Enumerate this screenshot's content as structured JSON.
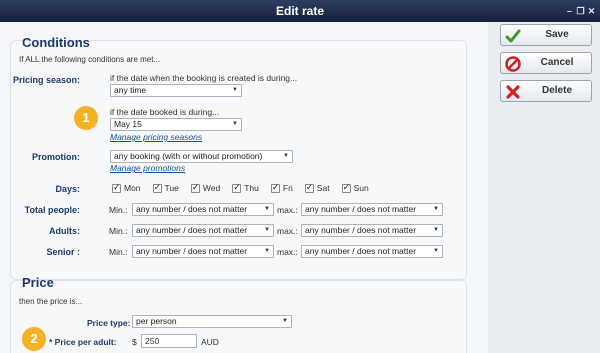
{
  "window": {
    "title": "Edit rate"
  },
  "conditions": {
    "title": "Conditions",
    "intro": "If ALL the following conditions are met...",
    "pricing_season": {
      "label": "Pricing season:",
      "text_created": "if the date when the booking is created is during...",
      "created_value": "any time",
      "text_booked": "if the date booked is during...",
      "booked_value": "May 15",
      "manage_link": "Manage pricing seasons"
    },
    "promotion": {
      "label": "Promotion:",
      "value": "any booking (with or without promotion)",
      "manage_link": "Manage promotions"
    },
    "days": {
      "label": "Days:",
      "items": [
        "Mon",
        "Tue",
        "Wed",
        "Thu",
        "Fri",
        "Sat",
        "Sun"
      ]
    },
    "people": [
      {
        "label": "Total people:",
        "min_label": "Min.:",
        "min_value": "any number / does not matter",
        "max_label": "max.:",
        "max_value": "any number / does not matter"
      },
      {
        "label": "Adults:",
        "min_label": "Min.:",
        "min_value": "any number / does not matter",
        "max_label": "max.:",
        "max_value": "any number / does not matter"
      },
      {
        "label": "Senior :",
        "min_label": "Min.:",
        "min_value": "any number / does not matter",
        "max_label": "max.:",
        "max_value": "any number / does not matter"
      }
    ]
  },
  "price": {
    "title": "Price",
    "intro": "then the price is...",
    "type_label": "Price type:",
    "type_value": "per person",
    "per_adult_label": "* Price per adult:",
    "currency_symbol": "$",
    "per_adult_value": "250",
    "currency_code": "AUD"
  },
  "badges": [
    "1",
    "2"
  ],
  "actions": {
    "save": "Save",
    "cancel": "Cancel",
    "delete": "Delete"
  },
  "colors": {
    "title_bar": "#1f2d4e",
    "heading": "#1c3a6e",
    "badge": "#f5b224",
    "link": "#1a4f96"
  },
  "icons": {
    "save": "checkmark-icon",
    "cancel": "no-entry-icon",
    "delete": "x-icon"
  }
}
